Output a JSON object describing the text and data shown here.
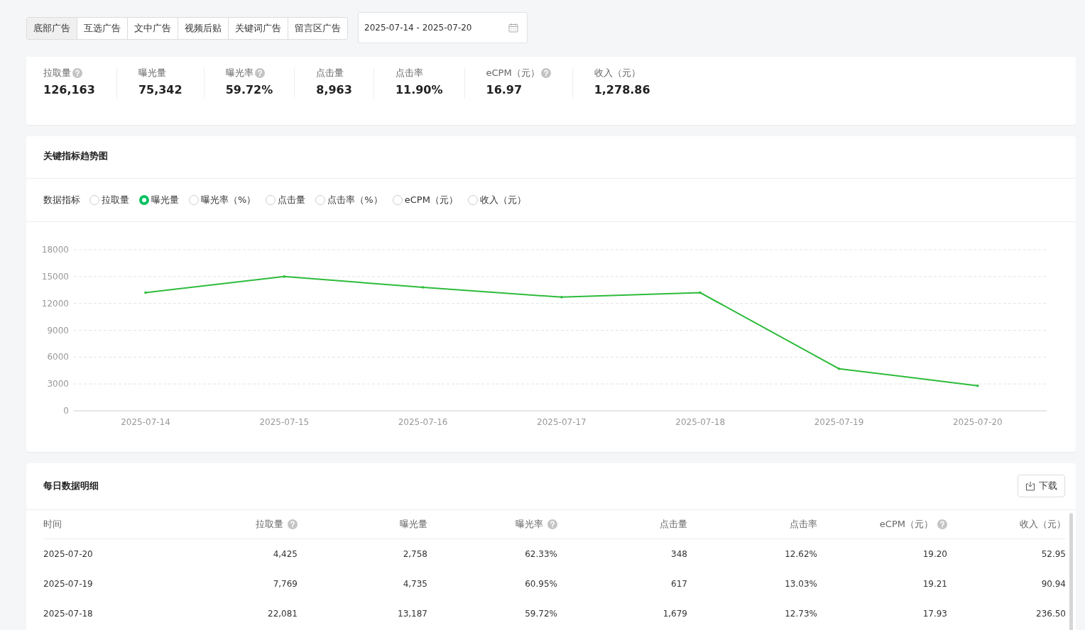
{
  "ad_tabs": [
    {
      "label": "底部广告",
      "selected": true
    },
    {
      "label": "互选广告",
      "selected": false
    },
    {
      "label": "文中广告",
      "selected": false
    },
    {
      "label": "视频后贴",
      "selected": false
    },
    {
      "label": "关键词广告",
      "selected": false
    },
    {
      "label": "留言区广告",
      "selected": false
    }
  ],
  "date_range": {
    "value": "2025-07-14 - 2025-07-20"
  },
  "summary": [
    {
      "label": "拉取量",
      "help": true,
      "value": "126,163"
    },
    {
      "label": "曝光量",
      "help": false,
      "value": "75,342"
    },
    {
      "label": "曝光率",
      "help": true,
      "value": "59.72%"
    },
    {
      "label": "点击量",
      "help": false,
      "value": "8,963"
    },
    {
      "label": "点击率",
      "help": false,
      "value": "11.90%"
    },
    {
      "label": "eCPM（元）",
      "help": true,
      "value": "16.97"
    },
    {
      "label": "收入（元）",
      "help": false,
      "value": "1,278.86"
    }
  ],
  "trend": {
    "title": "关键指标趋势图",
    "metric_label": "数据指标",
    "metrics": [
      {
        "label": "拉取量",
        "selected": false
      },
      {
        "label": "曝光量",
        "selected": true
      },
      {
        "label": "曝光率（%）",
        "selected": false
      },
      {
        "label": "点击量",
        "selected": false
      },
      {
        "label": "点击率（%）",
        "selected": false
      },
      {
        "label": "eCPM（元）",
        "selected": false
      },
      {
        "label": "收入（元）",
        "selected": false
      }
    ],
    "chart_data": {
      "type": "line",
      "categories": [
        "2025-07-14",
        "2025-07-15",
        "2025-07-16",
        "2025-07-17",
        "2025-07-18",
        "2025-07-19",
        "2025-07-20"
      ],
      "series": [
        {
          "color": "#2dbb3a",
          "values": [
            13200,
            15000,
            13800,
            12700,
            13200,
            4700,
            2800
          ]
        }
      ],
      "grid": true,
      "ylim": [
        0,
        18000
      ],
      "yticks": [
        0,
        3000,
        6000,
        9000,
        12000,
        15000,
        18000
      ]
    }
  },
  "daily": {
    "title": "每日数据明细",
    "download_button": "下载",
    "columns": [
      {
        "label": "时间",
        "help": false
      },
      {
        "label": "拉取量",
        "help": true
      },
      {
        "label": "曝光量",
        "help": false
      },
      {
        "label": "曝光率",
        "help": true
      },
      {
        "label": "点击量",
        "help": false
      },
      {
        "label": "点击率",
        "help": false
      },
      {
        "label": "eCPM（元）",
        "help": true
      },
      {
        "label": "收入（元）",
        "help": false
      }
    ],
    "rows": [
      [
        "2025-07-20",
        "4,425",
        "2,758",
        "62.33%",
        "348",
        "12.62%",
        "19.20",
        "52.95"
      ],
      [
        "2025-07-19",
        "7,769",
        "4,735",
        "60.95%",
        "617",
        "13.03%",
        "19.21",
        "90.94"
      ],
      [
        "2025-07-18",
        "22,081",
        "13,187",
        "59.72%",
        "1,679",
        "12.73%",
        "17.93",
        "236.50"
      ]
    ]
  }
}
